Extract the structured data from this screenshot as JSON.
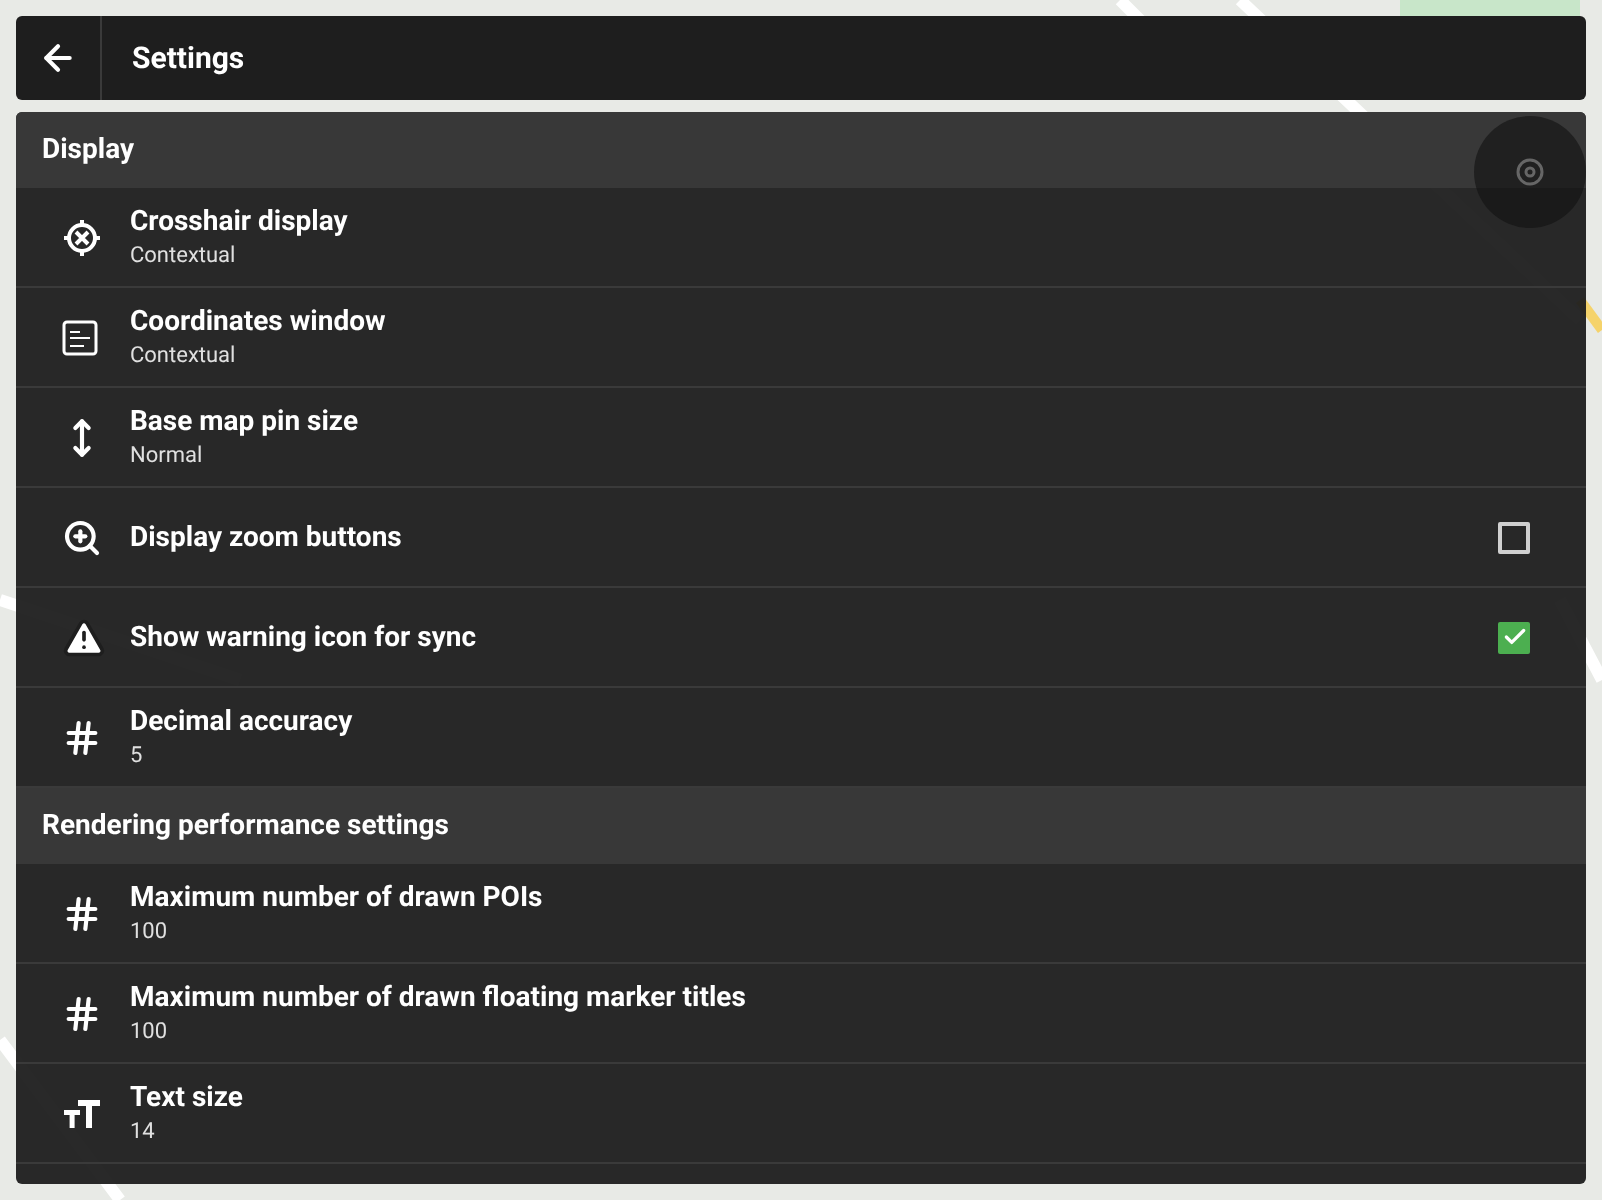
{
  "header": {
    "title": "Settings"
  },
  "sections": [
    {
      "title": "Display",
      "items": [
        {
          "kind": "value",
          "title": "Crosshair display",
          "value": "Contextual"
        },
        {
          "kind": "value",
          "title": "Coordinates window",
          "value": "Contextual"
        },
        {
          "kind": "value",
          "title": "Base map pin size",
          "value": "Normal"
        },
        {
          "kind": "checkbox",
          "title": "Display zoom buttons",
          "checked": false
        },
        {
          "kind": "checkbox",
          "title": "Show warning icon for sync",
          "checked": true
        },
        {
          "kind": "value",
          "title": "Decimal accuracy",
          "value": "5"
        }
      ]
    },
    {
      "title": "Rendering performance settings",
      "items": [
        {
          "kind": "value",
          "title": "Maximum number of drawn POIs",
          "value": "100"
        },
        {
          "kind": "value",
          "title": "Maximum number of drawn floating marker titles",
          "value": "100"
        },
        {
          "kind": "value",
          "title": "Text size",
          "value": "14"
        }
      ]
    }
  ]
}
